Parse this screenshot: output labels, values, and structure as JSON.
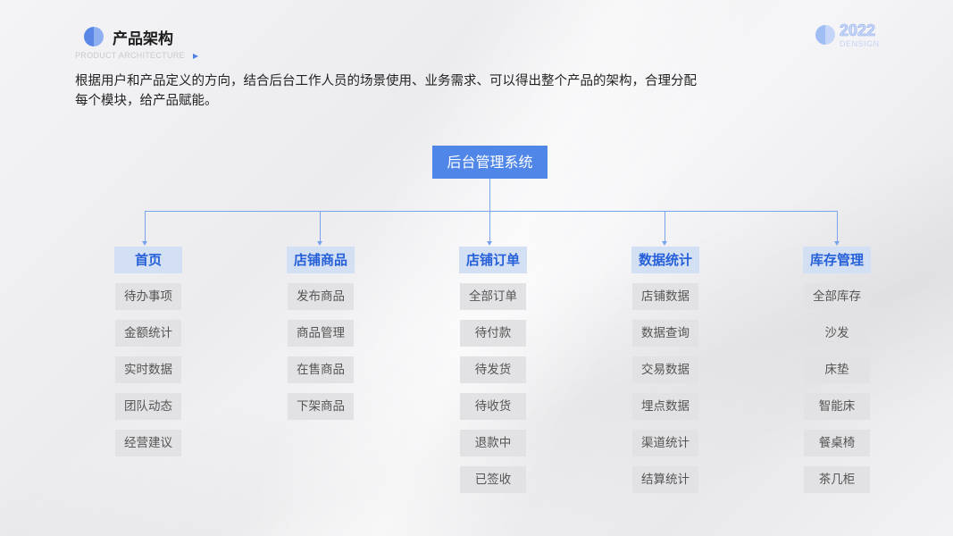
{
  "header": {
    "title": "产品架构",
    "subtitle": "PRODUCT ARCHITECTURE",
    "logo_year": "2022",
    "logo_word": "DENSIGN"
  },
  "intro": {
    "line1": "根据用户和产品定义的方向，结合后台工作人员的场景使用、业务需求、可以得出整个产品的架构，合理分配",
    "line2": "每个模块，给产品赋能。"
  },
  "root": {
    "label": "后台管理系统"
  },
  "columns": [
    {
      "label": "首页",
      "items": [
        "待办事项",
        "金额统计",
        "实时数据",
        "团队动态",
        "经营建议"
      ]
    },
    {
      "label": "店铺商品",
      "items": [
        "发布商品",
        "商品管理",
        "在售商品",
        "下架商品"
      ]
    },
    {
      "label": "店铺订单",
      "items": [
        "全部订单",
        "待付款",
        "待发货",
        "待收货",
        "退款中",
        "已签收"
      ]
    },
    {
      "label": "数据统计",
      "items": [
        "店铺数据",
        "数据查询",
        "交易数据",
        "埋点数据",
        "渠道统计",
        "结算统计"
      ]
    },
    {
      "label": "库存管理",
      "items": [
        "全部库存",
        "沙发",
        "床垫",
        "智能床",
        "餐桌椅",
        "茶几柜"
      ]
    }
  ],
  "colors": {
    "accent": "#4f86e8",
    "header_fill": "#d3dff3",
    "header_text": "#2560d8",
    "item_fill": "#e2e2e4",
    "connector": "#7aa3ee"
  }
}
